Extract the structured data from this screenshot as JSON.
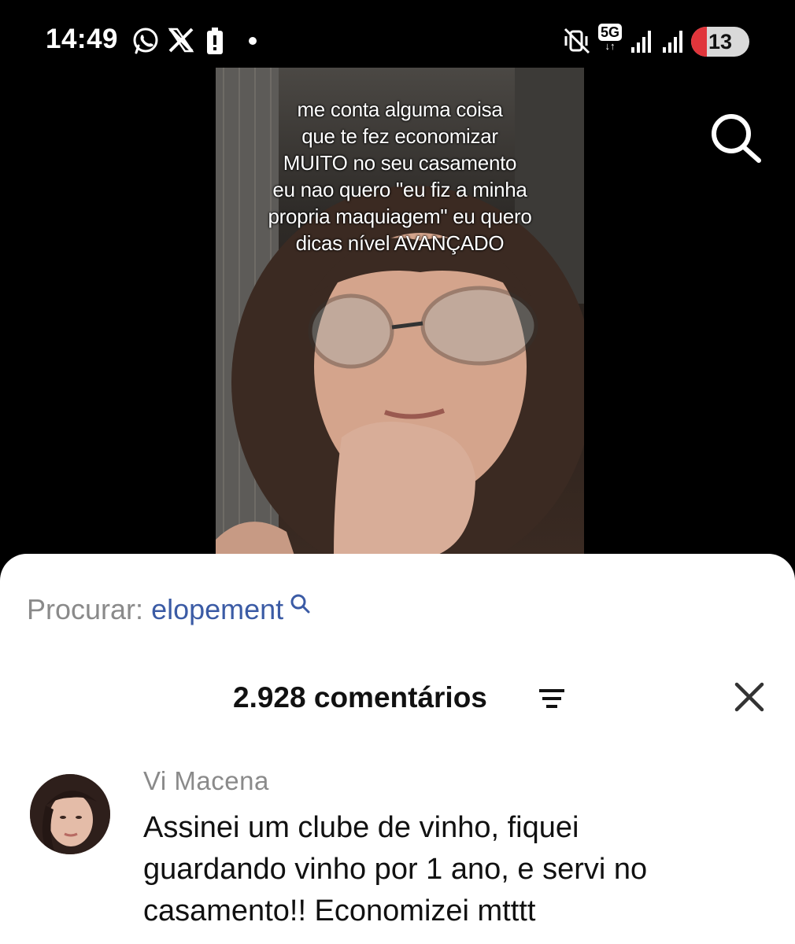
{
  "status_bar": {
    "time": "14:49",
    "network": "5G",
    "battery_level": "13",
    "left_icons": [
      "whatsapp-icon",
      "x-icon",
      "battery-alert-icon",
      "dot-icon"
    ],
    "right_icons": [
      "vibrate-icon",
      "5g-icon",
      "signal-icon",
      "signal-icon",
      "battery-icon"
    ]
  },
  "video": {
    "caption_lines": [
      "me conta alguma coisa",
      "que te fez economizar",
      "MUITO no seu casamento",
      "eu nao quero \"eu fiz a minha",
      "propria maquiagem\" eu quero",
      "dicas nível AVANÇADO"
    ]
  },
  "sheet": {
    "search_prefix": "Procurar:",
    "search_term": "elopement",
    "comments_count": "2.928 comentários",
    "comments": [
      {
        "author": "Vi Macena",
        "text_lines": [
          "Assinei um clube de vinho, fiquei",
          "guardando vinho por 1 ano, e servi no",
          "casamento!! Economizei mtttt"
        ]
      }
    ]
  },
  "colors": {
    "background": "#000000",
    "sheet": "#ffffff",
    "search_term": "#3b5ba5",
    "muted_text": "#8a8a8a",
    "battery_low": "#e0353b"
  }
}
